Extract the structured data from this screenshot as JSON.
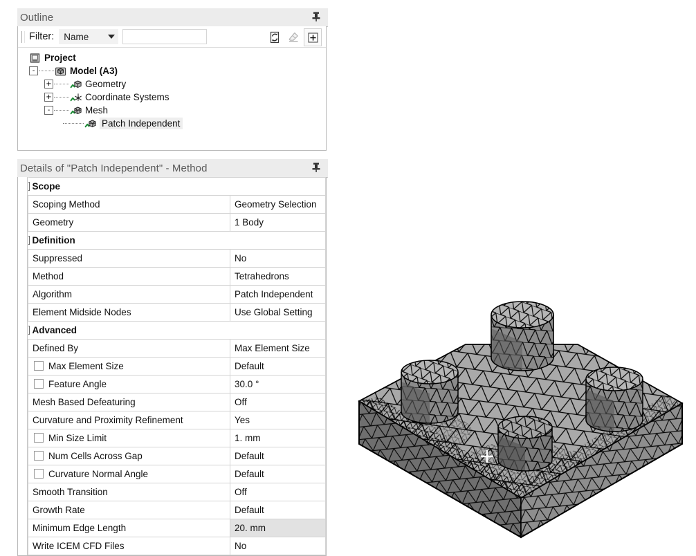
{
  "outline": {
    "header_title": "Outline",
    "pin_icon": "pushpin-icon",
    "filter": {
      "label": "Filter:",
      "selected": "Name",
      "input_value": "",
      "input_placeholder": "",
      "buttons": [
        {
          "name": "refresh-icon",
          "title": "Refresh"
        },
        {
          "name": "eraser-icon",
          "title": "Clear"
        },
        {
          "name": "expand-all-icon",
          "title": "Expand All"
        }
      ]
    },
    "tree": [
      {
        "label": "Project",
        "depth": 0,
        "expander": "",
        "icon": "project-icon",
        "bold": true,
        "selected": false,
        "check": false
      },
      {
        "label": "Model (A3)",
        "depth": 1,
        "expander": "-",
        "icon": "model-icon",
        "bold": true,
        "selected": false,
        "check": false
      },
      {
        "label": "Geometry",
        "depth": 2,
        "expander": "+",
        "icon": "geometry-icon",
        "bold": false,
        "selected": false,
        "check": true
      },
      {
        "label": "Coordinate Systems",
        "depth": 2,
        "expander": "+",
        "icon": "coordinate-systems-icon",
        "bold": false,
        "selected": false,
        "check": true
      },
      {
        "label": "Mesh",
        "depth": 2,
        "expander": "-",
        "icon": "mesh-icon",
        "bold": false,
        "selected": false,
        "check": true
      },
      {
        "label": "Patch Independent",
        "depth": 3,
        "expander": "",
        "icon": "mesh-method-icon",
        "bold": false,
        "selected": true,
        "check": true
      }
    ]
  },
  "details": {
    "header_title": "Details of \"Patch Independent\" - Method",
    "pin_icon": "pushpin-icon",
    "rows": [
      {
        "type": "section",
        "name": "Scope",
        "value": "",
        "collapse": "-"
      },
      {
        "type": "row",
        "name": "Scoping Method",
        "value": "Geometry Selection",
        "checkbox": false,
        "indent": false,
        "highlight": false
      },
      {
        "type": "row",
        "name": "Geometry",
        "value": "1 Body",
        "checkbox": false,
        "indent": false,
        "highlight": false
      },
      {
        "type": "section",
        "name": "Definition",
        "value": "",
        "collapse": "-"
      },
      {
        "type": "row",
        "name": "Suppressed",
        "value": "No",
        "checkbox": false,
        "indent": false,
        "highlight": false
      },
      {
        "type": "row",
        "name": "Method",
        "value": "Tetrahedrons",
        "checkbox": false,
        "indent": false,
        "highlight": false
      },
      {
        "type": "row",
        "name": "Algorithm",
        "value": "Patch Independent",
        "checkbox": false,
        "indent": false,
        "highlight": false
      },
      {
        "type": "row",
        "name": "Element Midside Nodes",
        "value": "Use Global Setting",
        "checkbox": false,
        "indent": false,
        "highlight": false
      },
      {
        "type": "section",
        "name": "Advanced",
        "value": "",
        "collapse": "-"
      },
      {
        "type": "row",
        "name": "Defined By",
        "value": "Max Element Size",
        "checkbox": false,
        "indent": false,
        "highlight": false
      },
      {
        "type": "row",
        "name": "Max Element Size",
        "value": "Default",
        "checkbox": true,
        "checked": false,
        "indent": true,
        "highlight": false
      },
      {
        "type": "row",
        "name": "Feature Angle",
        "value": "30.0 °",
        "checkbox": true,
        "checked": false,
        "indent": true,
        "highlight": false
      },
      {
        "type": "row",
        "name": "Mesh Based Defeaturing",
        "value": "Off",
        "checkbox": false,
        "indent": false,
        "highlight": false
      },
      {
        "type": "row",
        "name": "Curvature and Proximity Refinement",
        "value": "Yes",
        "checkbox": false,
        "indent": false,
        "highlight": false
      },
      {
        "type": "row",
        "name": "Min Size Limit",
        "value": "1. mm",
        "checkbox": true,
        "checked": false,
        "indent": true,
        "highlight": false
      },
      {
        "type": "row",
        "name": "Num Cells Across Gap",
        "value": "Default",
        "checkbox": true,
        "checked": false,
        "indent": true,
        "highlight": false
      },
      {
        "type": "row",
        "name": "Curvature Normal Angle",
        "value": "Default",
        "checkbox": true,
        "checked": false,
        "indent": true,
        "highlight": false
      },
      {
        "type": "row",
        "name": "Smooth Transition",
        "value": "Off",
        "checkbox": false,
        "indent": false,
        "highlight": false
      },
      {
        "type": "row",
        "name": "Growth Rate",
        "value": "Default",
        "checkbox": false,
        "indent": false,
        "highlight": false
      },
      {
        "type": "row",
        "name": "Minimum Edge Length",
        "value": "20. mm",
        "checkbox": false,
        "indent": false,
        "highlight": true
      },
      {
        "type": "row",
        "name": "Write ICEM CFD Files",
        "value": "No",
        "checkbox": false,
        "indent": false,
        "highlight": false
      }
    ]
  },
  "viewport": {
    "name": "mesh-3d-view",
    "description": "Tetrahedral mesh on square plate with four cylindrical bosses",
    "cursor_marker": "crosshair-cursor",
    "colors": {
      "top_face": "#a8a8a8",
      "front_face": "#757575",
      "side_face": "#8c8c8c",
      "boss_top": "#b4b4b4",
      "boss_side_light": "#a0a0a0",
      "boss_side_dark": "#6e6e6e",
      "mesh_line": "#000000",
      "background": "#ffffff"
    }
  },
  "theme": {
    "panel_header_bg": "#ececec",
    "panel_header_fg": "#5a5a5a",
    "border": "#b9b9b9",
    "grid_line": "#d3d3d3",
    "highlight": "#e2e2e2",
    "text": "#111111",
    "check_green": "#1e9e3c"
  }
}
